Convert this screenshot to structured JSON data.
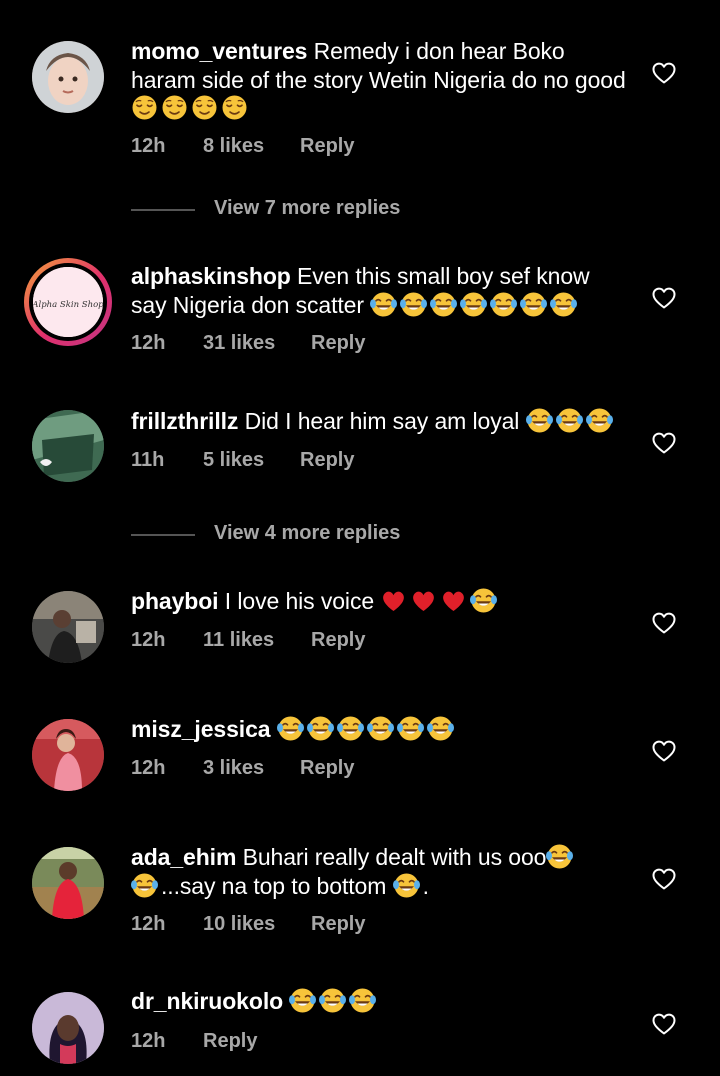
{
  "colors": {
    "background": "#000000",
    "text": "#ffffff",
    "secondary_text": "#a8a8a8",
    "divider": "#555555",
    "heart_red": "#e0202a",
    "emoji_yellow": "#f7c43a"
  },
  "comments": [
    {
      "username": "momo_ventures",
      "text": "Remedy i don hear Boko haram side of the story Wetin Nigeria do no good",
      "emojis": [
        "relieved-face-icon",
        "relieved-face-icon",
        "relieved-face-icon",
        "relieved-face-icon"
      ],
      "time": "12h",
      "likes": "8 likes",
      "reply": "Reply"
    },
    {
      "username": "alphaskinshop",
      "text": "Even this small boy sef know say Nigeria don scatter",
      "emojis": [
        "tears-of-joy-icon",
        "tears-of-joy-icon",
        "tears-of-joy-icon",
        "tears-of-joy-icon",
        "tears-of-joy-icon",
        "tears-of-joy-icon",
        "tears-of-joy-icon"
      ],
      "avatar_logo_text": "Alpha Skin Shop",
      "time": "12h",
      "likes": "31 likes",
      "reply": "Reply"
    },
    {
      "username": "frillzthrillz",
      "text": "Did I hear him say am loyal",
      "emojis": [
        "tears-of-joy-icon",
        "tears-of-joy-icon",
        "tears-of-joy-icon"
      ],
      "time": "11h",
      "likes": "5 likes",
      "reply": "Reply"
    },
    {
      "username": "phayboi",
      "text": "I love his voice",
      "emojis": [
        "red-heart-icon",
        "red-heart-icon",
        "red-heart-icon",
        "tears-of-joy-icon"
      ],
      "time": "12h",
      "likes": "11 likes",
      "reply": "Reply"
    },
    {
      "username": "misz_jessica",
      "text": "",
      "emojis": [
        "tears-of-joy-icon",
        "tears-of-joy-icon",
        "tears-of-joy-icon",
        "tears-of-joy-icon",
        "tears-of-joy-icon",
        "tears-of-joy-icon"
      ],
      "time": "12h",
      "likes": "3 likes",
      "reply": "Reply"
    },
    {
      "username": "ada_ehim",
      "text_part1": "Buhari really dealt  with us ooo",
      "text_part2": "...say na top to bottom",
      "text_part3": ".",
      "time": "12h",
      "likes": "10 likes",
      "reply": "Reply"
    },
    {
      "username": "dr_nkiruokolo",
      "text": "",
      "emojis": [
        "tears-of-joy-icon",
        "tears-of-joy-icon",
        "tears-of-joy-icon"
      ],
      "time": "12h",
      "reply": "Reply"
    }
  ],
  "view_more": [
    {
      "label": "View 7 more replies"
    },
    {
      "label": "View 4 more replies"
    }
  ]
}
